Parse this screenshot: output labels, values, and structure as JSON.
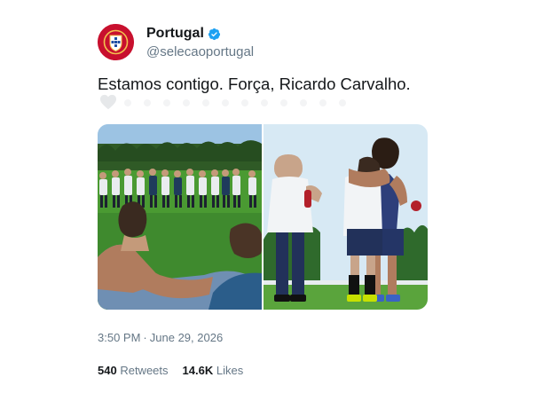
{
  "account": {
    "display_name": "Portugal",
    "handle": "@selecaoportugal",
    "verified_icon": "verified-badge-icon",
    "avatar_icon": "portugal-crest-icon",
    "brand_color": "#c8102e"
  },
  "tweet": {
    "text": "Estamos contigo. Força, Ricardo Carvalho.",
    "time": "3:50 PM",
    "separator": "·",
    "date": "June 29, 2026"
  },
  "stats": {
    "retweets_count": "540",
    "retweets_label": "Retweets",
    "likes_count": "14.6K",
    "likes_label": "Likes"
  },
  "colors": {
    "text_primary": "#14171a",
    "text_secondary": "#657786",
    "verified_blue": "#1da1f2",
    "pitch_green": "#3f8a2e"
  }
}
